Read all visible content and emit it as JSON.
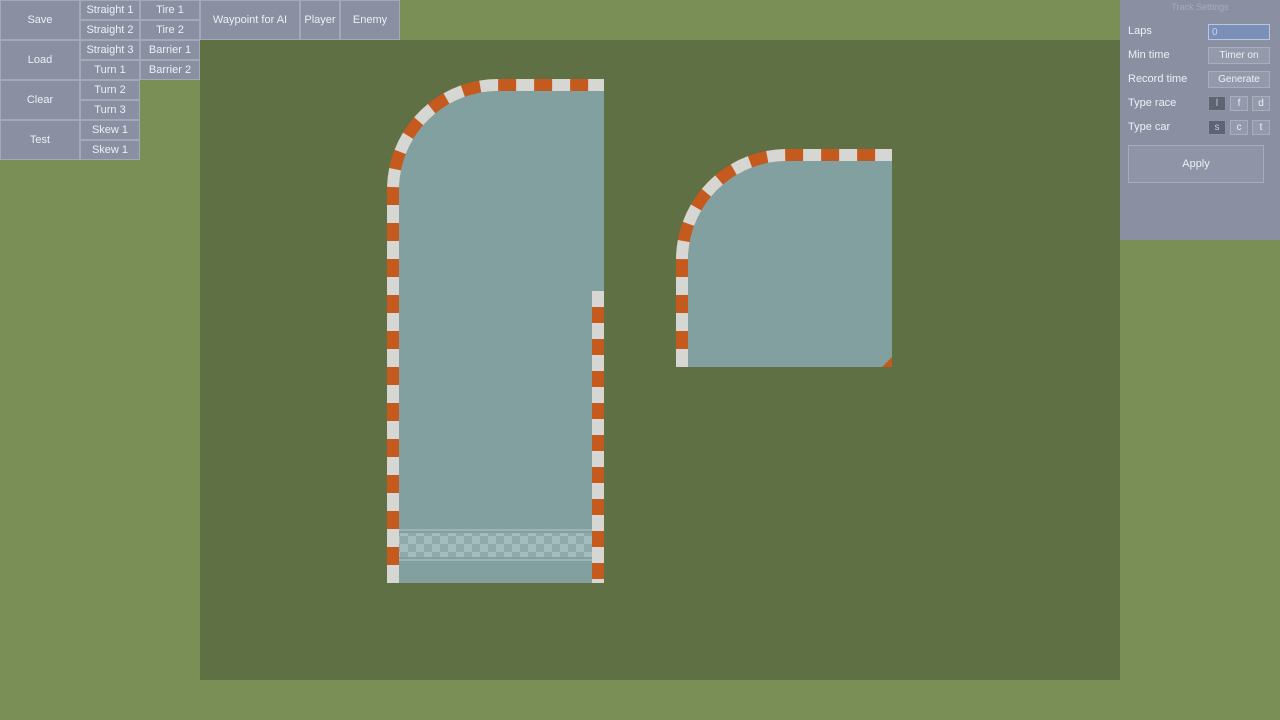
{
  "toolbar": {
    "save": "Save",
    "load": "Load",
    "clear": "Clear",
    "test": "Test",
    "straight_1": "Straight 1",
    "straight_2": "Straight 2",
    "straight_3": "Straight 3",
    "turn_1": "Turn 1",
    "turn_2": "Turn 2",
    "turn_3": "Turn 3",
    "skew_1a": "Skew 1",
    "skew_1b": "Skew 1",
    "tire_1": "Tire 1",
    "tire_2": "Tire 2",
    "barrier_1": "Barrier 1",
    "barrier_2": "Barrier 2",
    "waypoint": "Waypoint for AI",
    "player": "Player",
    "enemy": "Enemy"
  },
  "settings": {
    "title": "Track Settings",
    "laps_label": "Laps",
    "laps_value": "0",
    "min_time_label": "Min time",
    "timer_button": "Timer on",
    "record_time_label": "Record time",
    "generate_button": "Generate",
    "type_race_label": "Type race",
    "type_race_options": [
      "l",
      "f",
      "d"
    ],
    "type_car_label": "Type car",
    "type_car_options": [
      "s",
      "c",
      "t"
    ],
    "apply_button": "Apply"
  },
  "colors": {
    "background": "#7a8f56",
    "canvas": "#5f7045",
    "road": "#82a0a0",
    "curb_orange": "#c55a1f",
    "curb_white": "#d6d6d2",
    "panel": "#8a90a2"
  }
}
